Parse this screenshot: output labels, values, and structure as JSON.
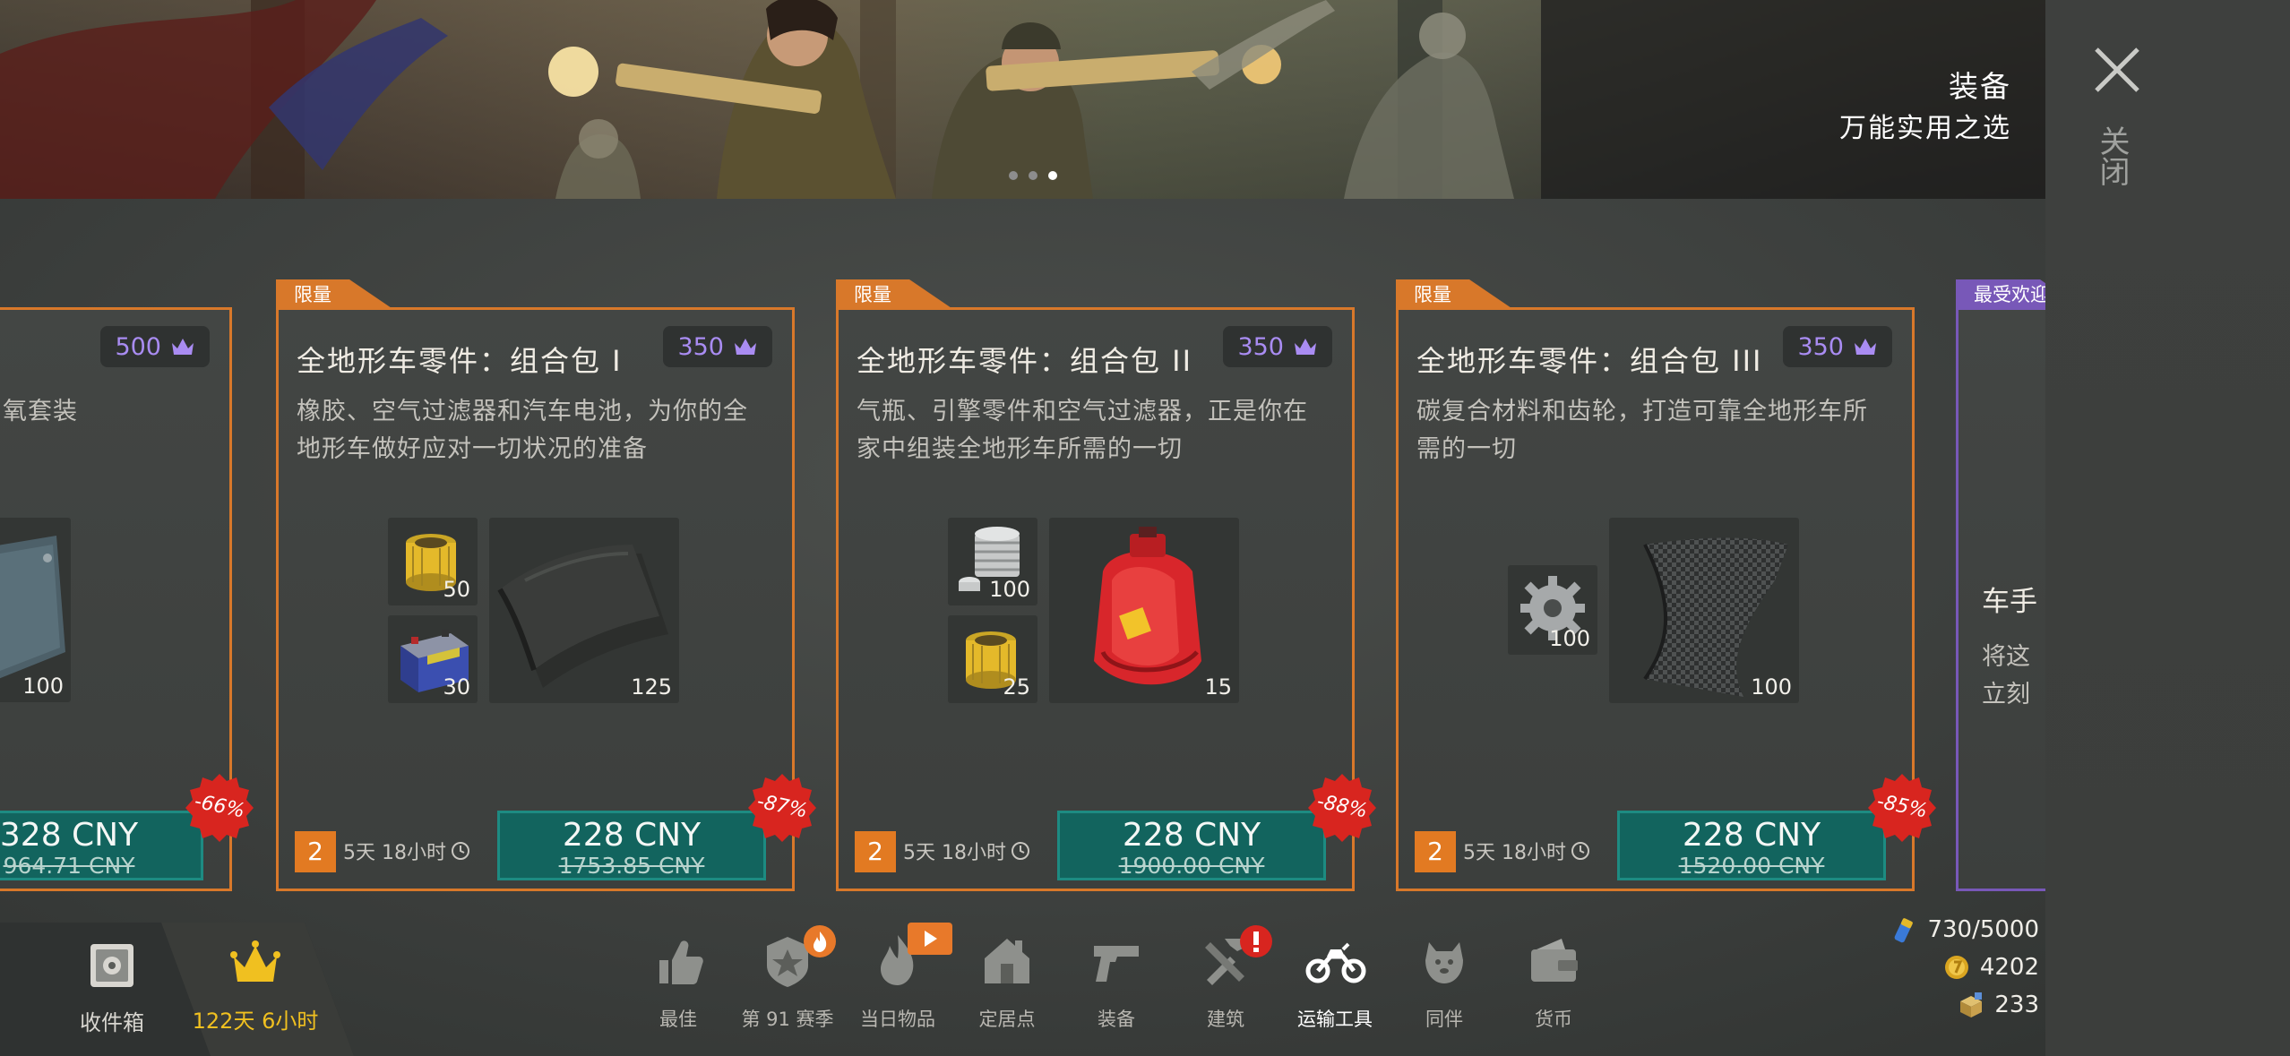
{
  "banner": {
    "title": "装备",
    "subtitle": "万能实用之选",
    "dots": 3,
    "active_dot": 2
  },
  "close": {
    "label": "关闭"
  },
  "cards": [
    {
      "id": "partial",
      "crown_price": "500",
      "desc_visible": "氧套装",
      "items": [
        {
          "qty": "100",
          "icon": "metal-plate-icon"
        }
      ],
      "price": "328 CNY",
      "old_price": "964.71 CNY",
      "discount": "-66%"
    },
    {
      "tag": "限量",
      "title": "全地形车零件：组合包 I",
      "crown_price": "350",
      "desc": "橡胶、空气过滤器和汽车电池，为你的全地形车做好应对一切状况的准备",
      "items": [
        {
          "qty": "50",
          "icon": "air-filter-icon"
        },
        {
          "qty": "30",
          "icon": "car-battery-icon"
        },
        {
          "qty": "125",
          "icon": "rubber-icon"
        }
      ],
      "limit": "2",
      "timer": "5天 18小时",
      "price": "228 CNY",
      "old_price": "1753.85 CNY",
      "discount": "-87%"
    },
    {
      "tag": "限量",
      "title": "全地形车零件：组合包 II",
      "crown_price": "350",
      "desc": "气瓶、引擎零件和空气过滤器，正是你在家中组装全地形车所需的一切",
      "items": [
        {
          "qty": "100",
          "icon": "engine-part-icon"
        },
        {
          "qty": "25",
          "icon": "air-filter-icon"
        },
        {
          "qty": "15",
          "icon": "gas-cylinder-icon"
        }
      ],
      "limit": "2",
      "timer": "5天 18小时",
      "price": "228 CNY",
      "old_price": "1900.00 CNY",
      "discount": "-88%"
    },
    {
      "tag": "限量",
      "title": "全地形车零件：组合包 III",
      "crown_price": "350",
      "desc": "碳复合材料和齿轮，打造可靠全地形车所需的一切",
      "items": [
        {
          "qty": "100",
          "icon": "gear-icon"
        },
        {
          "qty": "100",
          "icon": "carbon-composite-icon"
        }
      ],
      "limit": "2",
      "timer": "5天 18小时",
      "price": "228 CNY",
      "old_price": "1520.00 CNY",
      "discount": "-85%"
    },
    {
      "tag": "最受欢迎",
      "title_visible": "车手",
      "desc_visible_1": "将这",
      "desc_visible_2": "立刻"
    }
  ],
  "bottom": {
    "storage_label": "收件箱",
    "vip_label": "122天 6小时",
    "nav": [
      {
        "label": "最佳",
        "icon": "thumbs-up-icon"
      },
      {
        "label": "第 91 赛季",
        "icon": "season-badge-icon"
      },
      {
        "label": "当日物品",
        "icon": "flame-icon"
      },
      {
        "label": "定居点",
        "icon": "house-icon"
      },
      {
        "label": "装备",
        "icon": "pistol-icon"
      },
      {
        "label": "建筑",
        "icon": "tools-icon"
      },
      {
        "label": "运输工具",
        "icon": "motorcycle-icon"
      },
      {
        "label": "同伴",
        "icon": "dog-icon"
      },
      {
        "label": "货币",
        "icon": "wallet-icon"
      }
    ],
    "active_nav": "运输工具",
    "resources": [
      {
        "value": "730/5000",
        "icon": "energy-drink-icon"
      },
      {
        "value": "4202",
        "icon": "coin-icon"
      },
      {
        "value": "233",
        "icon": "crate-icon"
      }
    ]
  },
  "colors": {
    "accent_orange": "#d8782a",
    "accent_purple": "#7858b8",
    "buy_teal": "#12645e",
    "discount_red": "#d8251f",
    "crown_purple": "#a98cf2",
    "vip_gold": "#f0c020"
  }
}
